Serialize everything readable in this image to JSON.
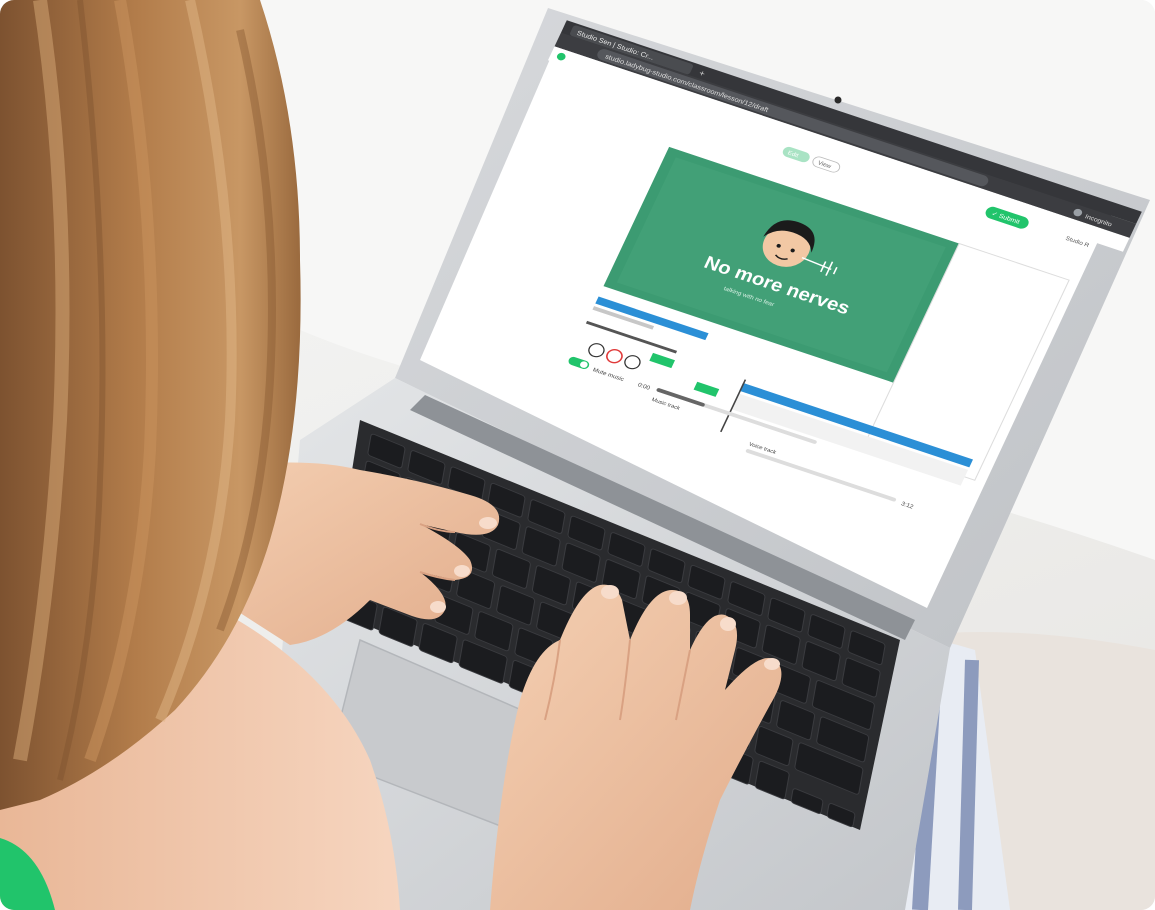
{
  "scene": {
    "background_color": "#f2f2f0",
    "hair_color": "#b07a48",
    "skin_color": "#f1c6a8",
    "laptop_color": "#d4d6d9",
    "keyboard_key_color": "#1c1c1e",
    "accent_green": "#21c46b",
    "slide_green": "#3c9b72"
  },
  "laptop_screen": {
    "browser": {
      "tab_title": "Studio Sen | Studio: Cr...",
      "tab_new": "+",
      "address": "studio.ladybug-studio.com/classroom/lesson/12/draft",
      "profile_label": "Incognito"
    },
    "app": {
      "top_tab_active": "Edit",
      "top_tab_other": "View",
      "submit_button": "✓ Submit",
      "header_link": "Studio R"
    },
    "slide": {
      "title": "No more nerves",
      "caption": "talking with no fear"
    },
    "timeline": {
      "toggle_label": "Mute music",
      "timer_start": "0:00",
      "timer_end": "3:12",
      "track_label": "Music track",
      "track_label_2": "Voice track"
    }
  }
}
